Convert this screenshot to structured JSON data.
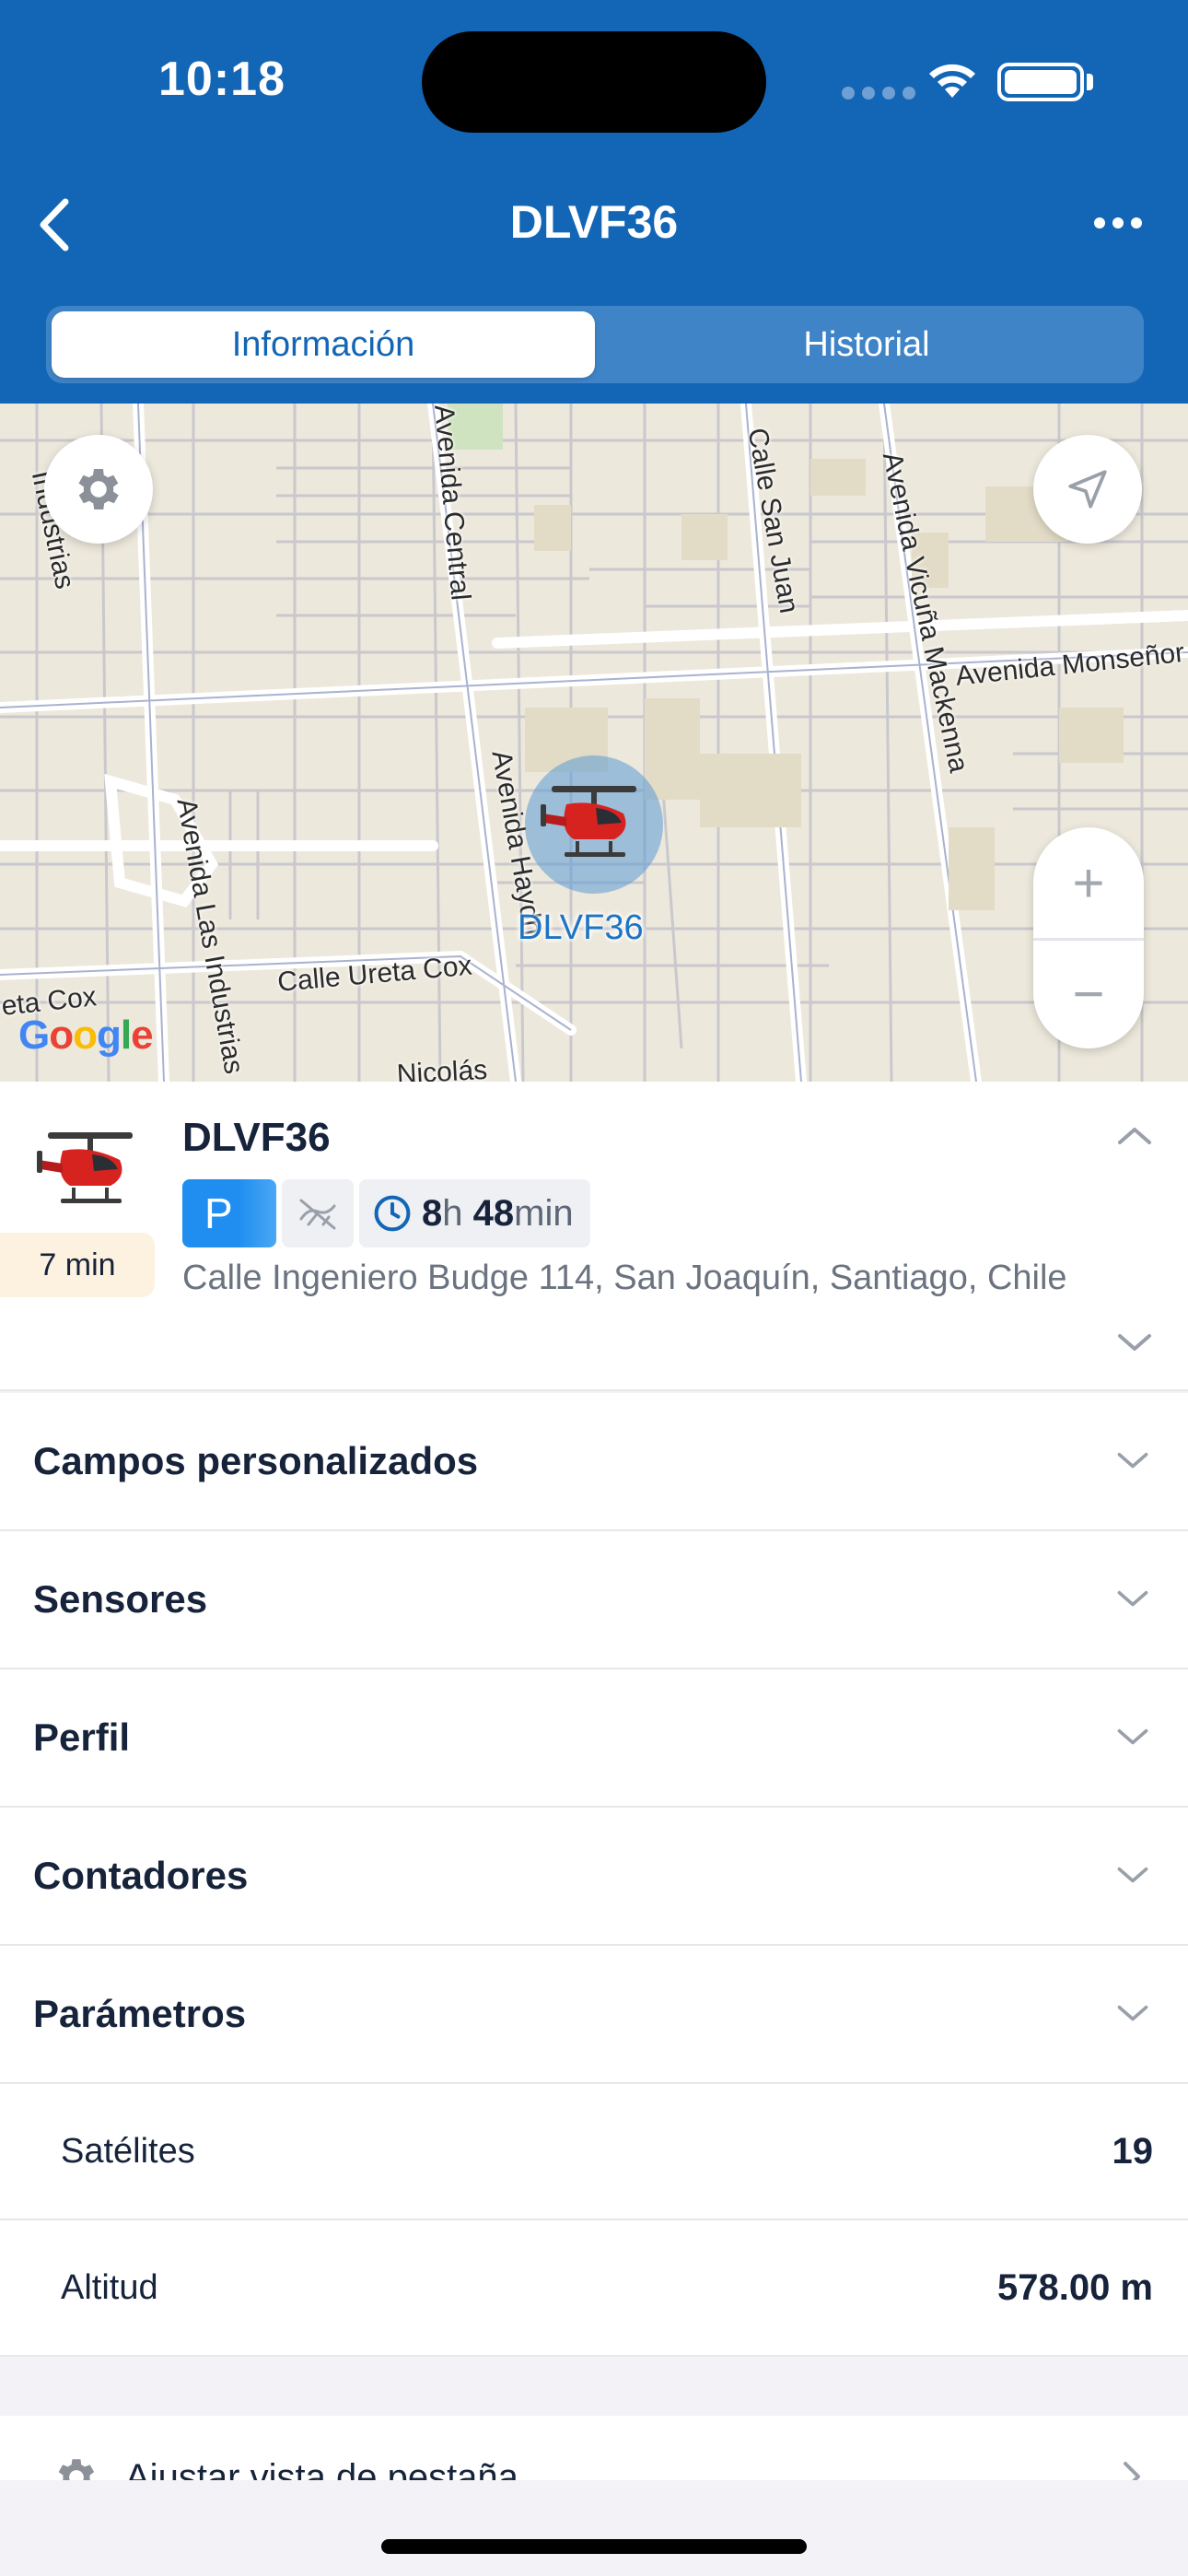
{
  "status_bar": {
    "time": "10:18"
  },
  "header": {
    "title": "DLVF36",
    "tabs": [
      {
        "label": "Información",
        "active": true
      },
      {
        "label": "Historial",
        "active": false
      }
    ]
  },
  "map": {
    "street_labels": {
      "industrias": "Industrias",
      "avenida_central": "Avenida Central",
      "calle_san_juan": "Calle San Juan",
      "avenida_vicuna_mackenna": "Avenida Vicuña Mackenna",
      "avenida_monsenor": "Avenida Monseñor",
      "avenida_haydn": "Avenida Haydn",
      "avenida_las_industrias": "Avenida Las Industrias",
      "calle_ureta_cox": "Calle Ureta Cox",
      "ureta_cox_left": "eta Cox",
      "nicolas": "Nicolás"
    },
    "marker_label": "DLVF36",
    "google_logo": "Google",
    "zoom_in": "+",
    "zoom_out": "−"
  },
  "unit": {
    "name": "DLVF36",
    "elapsed": "7 min",
    "status_badge": "P",
    "duration": {
      "hours": "8",
      "hours_unit": "h",
      "minutes": "48",
      "minutes_unit": "min"
    },
    "address": "Calle Ingeniero Budge 114, San Joaquín, Santiago, Chile"
  },
  "sections": [
    {
      "title": "Campos personalizados"
    },
    {
      "title": "Sensores"
    },
    {
      "title": "Perfil"
    },
    {
      "title": "Contadores"
    },
    {
      "title": "Parámetros"
    }
  ],
  "parameters": [
    {
      "label": "Satélites",
      "value": "19"
    },
    {
      "label": "Altitud",
      "value": "578.00 m"
    }
  ],
  "footer": {
    "adjust_label": "Ajustar vista de pestaña"
  },
  "colors": {
    "primary": "#1366b5",
    "accent": "#1f8ef0",
    "chip_bg": "#fdf1df"
  }
}
